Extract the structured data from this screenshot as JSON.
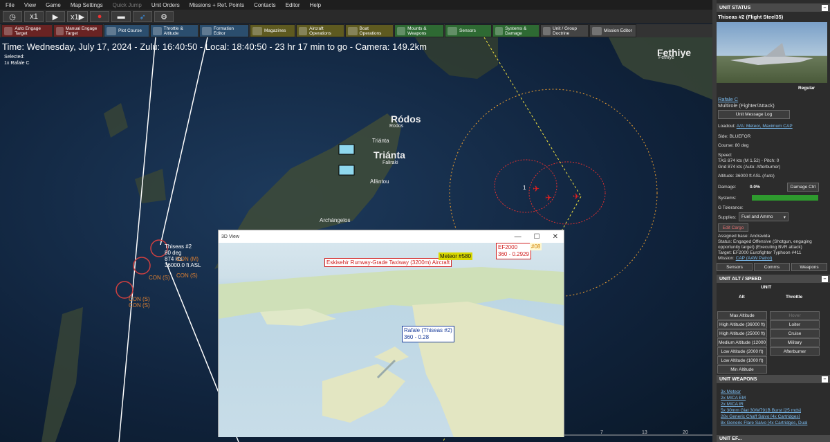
{
  "menu": [
    "File",
    "View",
    "Game",
    "Map Settings",
    "Quick Jump",
    "Unit Orders",
    "Missions + Ref. Points",
    "Contacts",
    "Editor",
    "Help"
  ],
  "toolbar1": [
    "◷",
    "x1",
    "▶",
    "x1▶",
    "●",
    "▬",
    "➶",
    "⚙"
  ],
  "toolbar2": [
    {
      "label": "Auto Engage Target",
      "color": "red"
    },
    {
      "label": "Manual Engage Target",
      "color": "red"
    },
    {
      "label": "Plot Course",
      "color": "blue"
    },
    {
      "label": "Throttle & Altitude",
      "color": "blue"
    },
    {
      "label": "Formation Editor",
      "color": "blue"
    },
    {
      "label": "Magazines",
      "color": "olive"
    },
    {
      "label": "Aircraft Operations",
      "color": "olive"
    },
    {
      "label": "Boat Operations",
      "color": "olive"
    },
    {
      "label": "Mounts & Weapons",
      "color": "green"
    },
    {
      "label": "Sensors",
      "color": "green"
    },
    {
      "label": "Systems & Damage",
      "color": "green"
    },
    {
      "label": "Unit / Group Doctrine",
      "color": "gray"
    },
    {
      "label": "Mission Editor",
      "color": "gray"
    }
  ],
  "map": {
    "status": "Time: Wednesday, July 17, 2024 - Zulu: 16:40:50 - Local: 18:40:50 - 23 hr 17 min to go - Camera: 149.2km",
    "selected_title": "Selected:",
    "selected_unit": "1x Rafale C",
    "places": {
      "rodos": "Ródos",
      "rodos_small": "Rodos",
      "trianta": "Triánta",
      "trianta_small": "Triánta",
      "faliraki": "Faliraki",
      "afantou": "Afántou",
      "archangelos": "Archángelos",
      "fethiye": "Fethiye",
      "fethiye_small": "Fethiye"
    },
    "unit_label": {
      "name": "Thiseas #2",
      "course": "80 deg",
      "speed": "874 kts",
      "alt": "36000.0 ft ASL",
      "con_m": "CON (M)",
      "con_s": "CON (S)"
    },
    "con_label": "CON (S)",
    "contact_num": "1",
    "scale": [
      "7",
      "13",
      "20"
    ]
  },
  "view3d": {
    "title": "3D View",
    "airport": "Eskisehir  Runway-Grade Taxiway (3200m)  Aircraft",
    "meteor": "Meteor #580",
    "ef_name": "EF2000",
    "ef_range": "360 - 0.2929",
    "ef_tag": "#08",
    "rafale_name": "Rafale (Thiseas #2)",
    "rafale_range": "360 - 0.28"
  },
  "panel": {
    "unit_status": "UNIT STATUS",
    "unit_name": "Thiseas #2 (Flight Steel35)",
    "proficiency": "Regular",
    "class": "Rafale C",
    "role": "Multirole (Fighter/Attack)",
    "msg_log": "Unit Message Log",
    "loadout_label": "Loadout:",
    "loadout": "A/A: Meteor, Maximum CAP",
    "side": "Side: BLUEFOR",
    "course": "Course: 80 deg",
    "speed_label": "Speed:",
    "tas": "TAS 874 kts (M 1.52) - Pitch: 0",
    "gnd": "Gnd 874 kts (Auto: Afterburner)",
    "altitude": "Altitude: 36000 ft ASL (Auto)",
    "damage_label": "Damage:",
    "damage_val": "0.0%",
    "damage_btn": "Damage Ctrl",
    "systems": "Systems:",
    "g_tol": "G Tolerance:",
    "supplies_label": "Supplies:",
    "supplies_val": "Fuel and Ammo",
    "edit_cargo": "Edit Cargo",
    "base": "Assigned base: Andravida",
    "status1": "Status: Engaged Offensive (Shotgun, engaging",
    "status2": "opportunity target) (Executing BVR attack)",
    "target": "Target: EF2000 Eurofighter Typhoon #411",
    "mission_label": "Mission:",
    "mission": "CAP (AAW Patrol)",
    "tabs": [
      "Sensors",
      "Comms",
      "Weapons"
    ],
    "alt_speed": "UNIT ALT / SPEED",
    "unit": "UNIT",
    "alt_col": "Alt",
    "throttle_col": "Throttle",
    "alt_buttons": [
      "Max Altitude",
      "High Altitude (36000 ft)",
      "High Altitude (25000 ft)",
      "Medium Altitude (12000",
      "Low Altitude (2000 ft)",
      "Low Altitude (1000 ft)",
      "Min Altitude"
    ],
    "throttle_buttons": [
      "Hover",
      "Loiter",
      "Cruise",
      "Military",
      "Afterburner"
    ],
    "unit_weapons": "UNIT WEAPONS",
    "weapons": [
      "3x Meteor",
      "2x MICA EM",
      "2x MICA IR",
      "5x 30mm Giat 30/M791B Burst [25 rnds]",
      "28x Generic Chaff Salvo [4x Cartridges]",
      "8x Generic Flare Salvo [4x Cartridges, Dual"
    ],
    "unit_ef": "UNIT EF..."
  }
}
